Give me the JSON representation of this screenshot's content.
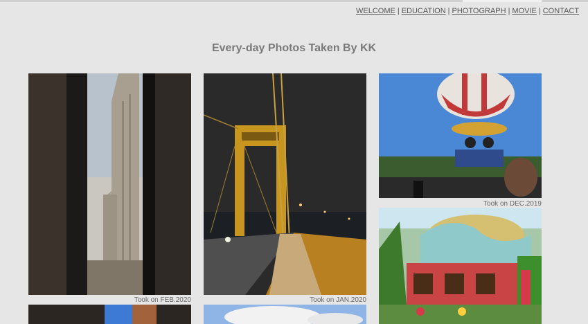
{
  "nav": {
    "items": [
      "WELCOME",
      "EDUCATION",
      "PHOTOGRAPH",
      "MOVIE",
      "CONTACT"
    ],
    "separator": "|"
  },
  "page": {
    "title": "Every-day Photos Taken By KK"
  },
  "photos": {
    "cathedral": {
      "caption": "Took on FEB.2020"
    },
    "bridge": {
      "caption": "Took on JAN.2020"
    },
    "balloon": {
      "caption": "Took on DEC.2019"
    },
    "whoville": {
      "caption": ""
    }
  },
  "colors": {
    "background": "#e6e6e6",
    "title": "#7a7a7a",
    "nav_text": "#555555"
  }
}
